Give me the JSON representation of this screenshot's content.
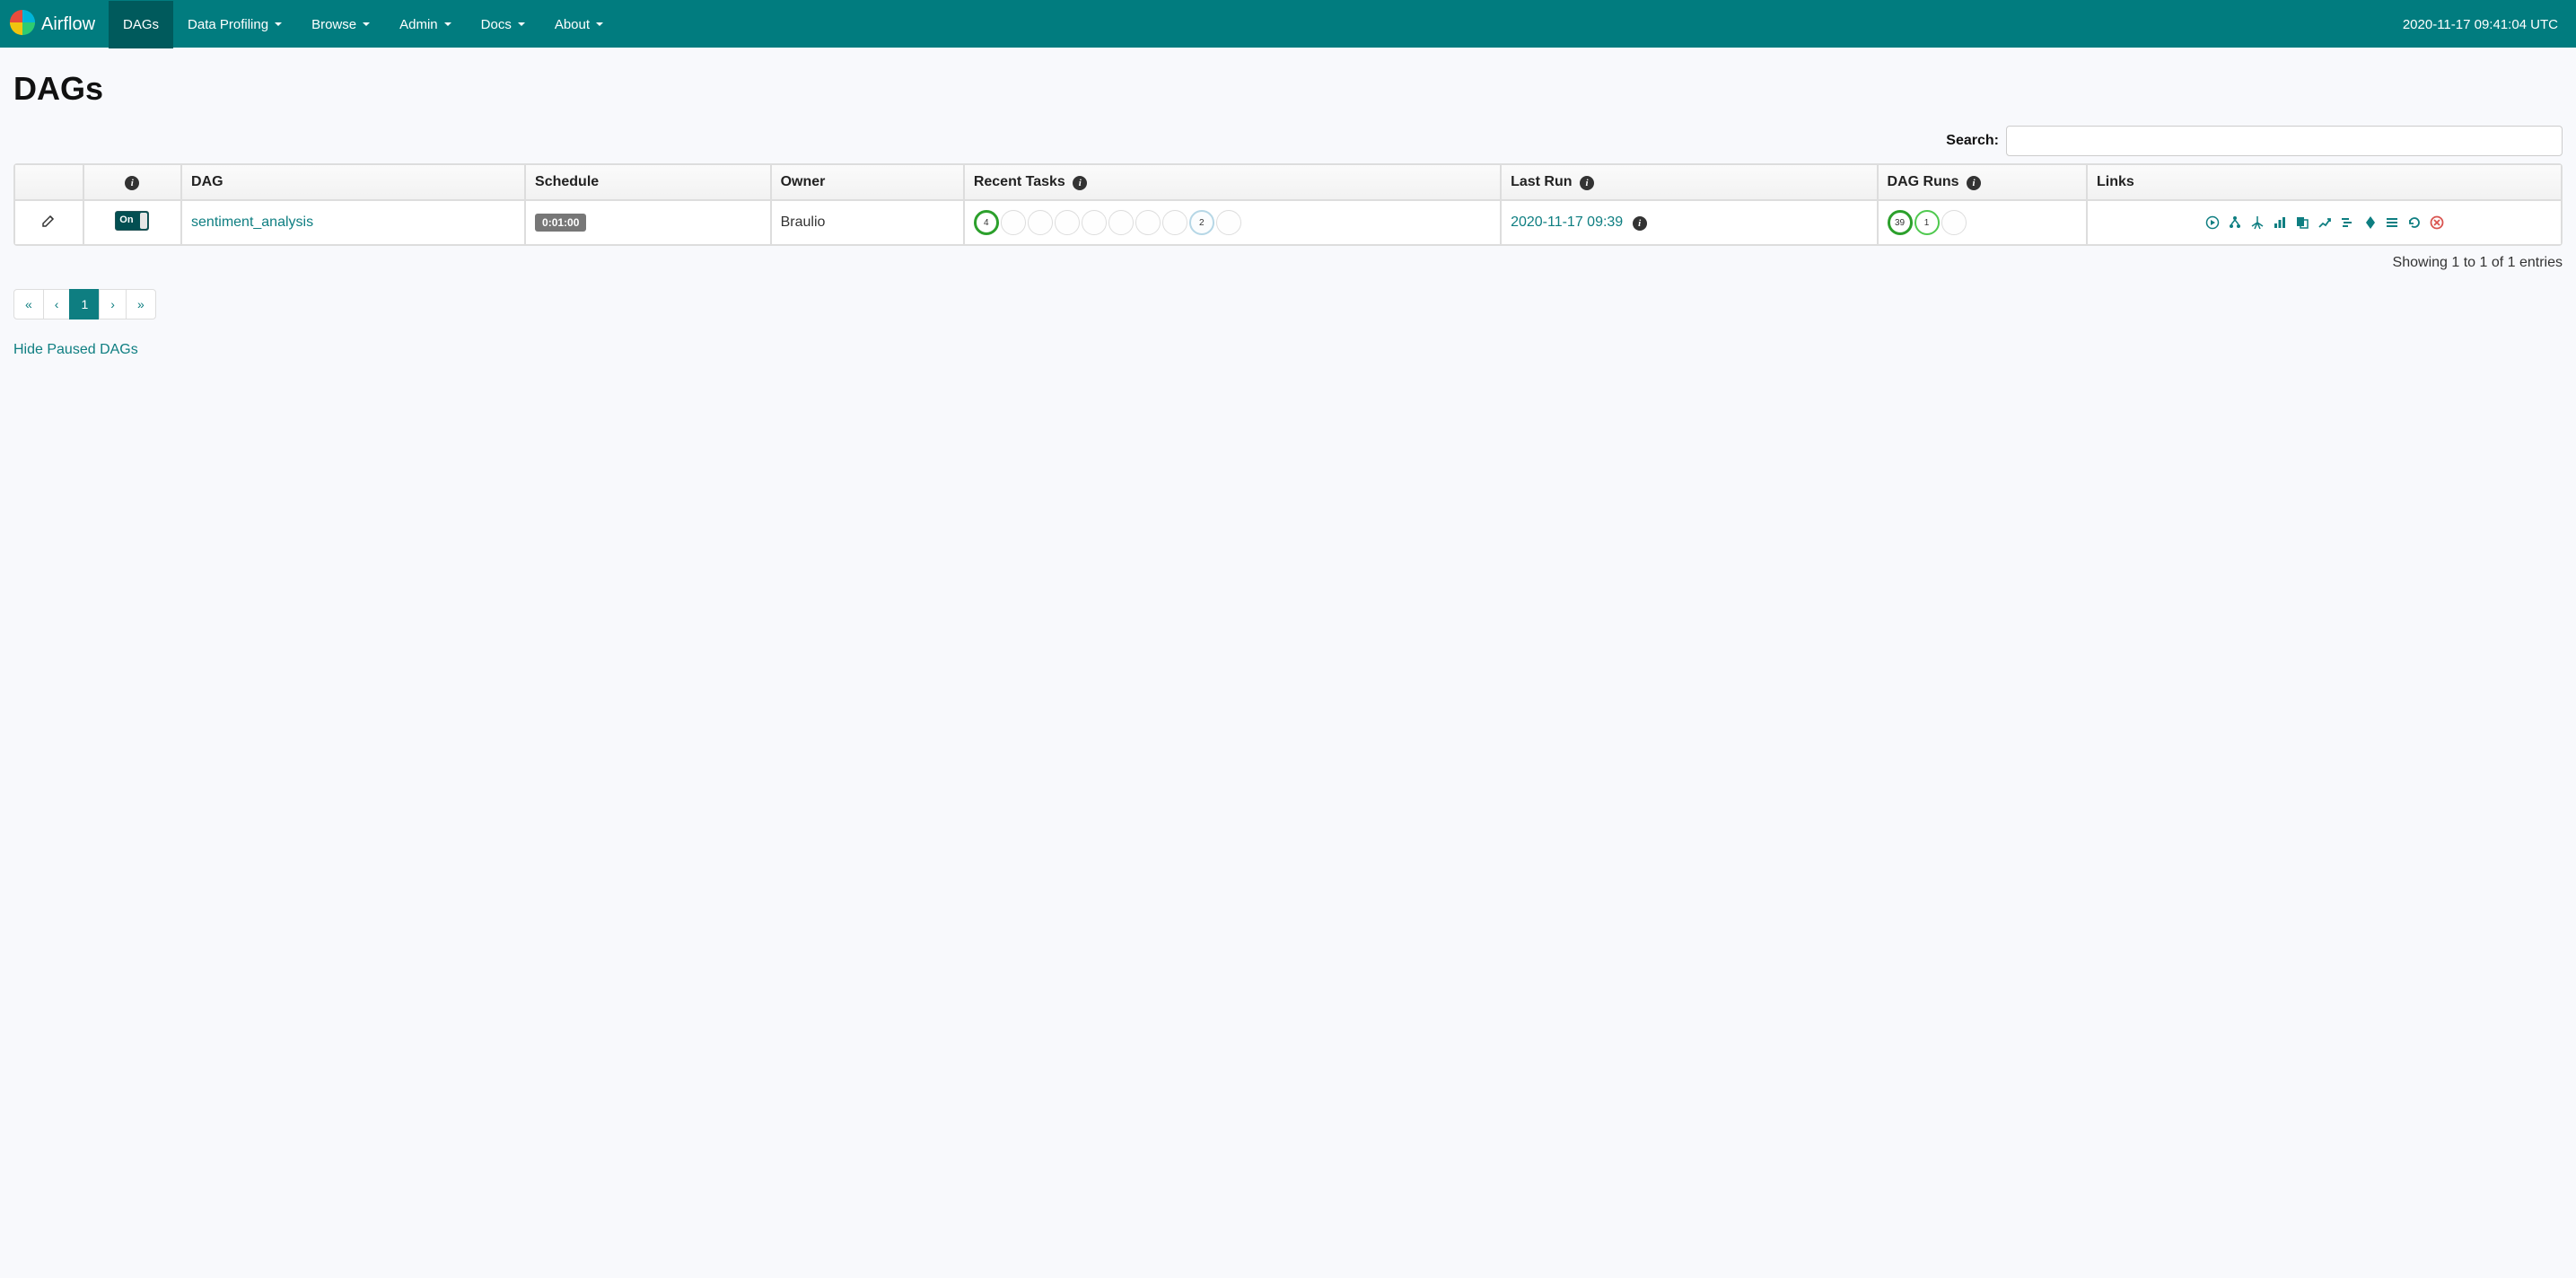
{
  "nav": {
    "brand": "Airflow",
    "items": [
      {
        "label": "DAGs",
        "active": true,
        "dropdown": false
      },
      {
        "label": "Data Profiling",
        "active": false,
        "dropdown": true
      },
      {
        "label": "Browse",
        "active": false,
        "dropdown": true
      },
      {
        "label": "Admin",
        "active": false,
        "dropdown": true
      },
      {
        "label": "Docs",
        "active": false,
        "dropdown": true
      },
      {
        "label": "About",
        "active": false,
        "dropdown": true
      }
    ],
    "clock": "2020-11-17 09:41:04 UTC"
  },
  "page": {
    "title": "DAGs",
    "search_label": "Search:",
    "search_value": ""
  },
  "table": {
    "headers": {
      "dag": "DAG",
      "schedule": "Schedule",
      "owner": "Owner",
      "recent_tasks": "Recent Tasks",
      "last_run": "Last Run",
      "dag_runs": "DAG Runs",
      "links": "Links"
    },
    "rows": [
      {
        "toggle": "On",
        "dag_id": "sentiment_analysis",
        "schedule": "0:01:00",
        "owner": "Braulio",
        "recent_tasks": {
          "first": "4",
          "extras": 7,
          "running": "2"
        },
        "last_run": "2020-11-17 09:39",
        "dag_runs": {
          "success": "39",
          "running": "1"
        }
      }
    ]
  },
  "footer": {
    "showing": "Showing 1 to 1 of 1 entries"
  },
  "pagination": {
    "first": "«",
    "prev": "‹",
    "current": "1",
    "next": "›",
    "last": "»"
  },
  "hide_paused": "Hide Paused DAGs"
}
